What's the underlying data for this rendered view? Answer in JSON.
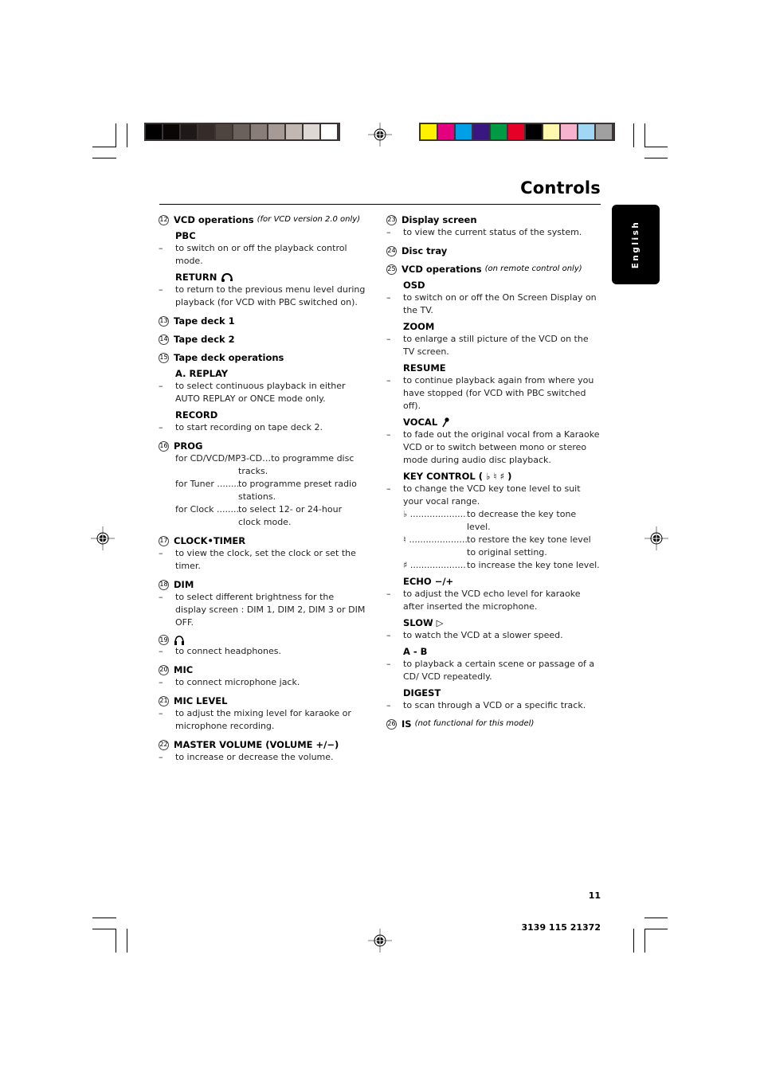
{
  "page": {
    "title": "Controls",
    "language_tab": "English",
    "page_number": "11",
    "doc_code": "3139 115 21372"
  },
  "print_marks": {
    "gray_bar_colors": [
      "#000000",
      "#0a0606",
      "#1e1917",
      "#352c2a",
      "#4e4541",
      "#6a605c",
      "#887d79",
      "#a69a96",
      "#c1b7b3",
      "#ded8d5",
      "#ffffff"
    ],
    "color_bar_colors": [
      "#fff100",
      "#e4007f",
      "#00a0e9",
      "#3a1780",
      "#009a44",
      "#e60027",
      "#000000",
      "#fff9b0",
      "#f6b3cb",
      "#a1d7f4",
      "#a0a0a0"
    ]
  },
  "left_column": [
    {
      "num": "12",
      "title": "VCD operations",
      "note": "(for VCD version 2.0 only)",
      "subs": [
        {
          "label": "PBC",
          "icon": "",
          "desc": "to switch on or off the playback control mode."
        },
        {
          "label": "RETURN",
          "icon": "return-icon",
          "desc": "to return to the previous menu level during playback (for VCD with PBC switched on)."
        }
      ]
    },
    {
      "num": "13",
      "title": "Tape deck 1"
    },
    {
      "num": "14",
      "title": "Tape deck 2"
    },
    {
      "num": "15",
      "title": "Tape deck operations",
      "subs": [
        {
          "label": "A. REPLAY",
          "desc": "to select continuous playback in either AUTO REPLAY or ONCE mode only."
        },
        {
          "label": "RECORD",
          "desc": "to start recording on tape deck 2."
        }
      ]
    },
    {
      "num": "16",
      "title": "PROG",
      "intro": "for CD/VCD/MP3-CD…to programme disc",
      "intro_cont": "tracks.",
      "rows": [
        {
          "k": "for Tuner .............",
          "v": "to programme preset radio stations."
        },
        {
          "k": "for Clock ............",
          "v": "to select 12- or 24-hour clock mode."
        }
      ]
    },
    {
      "num": "17",
      "title": "CLOCK•TIMER",
      "desc": "to view the clock, set the clock or set the timer."
    },
    {
      "num": "18",
      "title": "DIM",
      "desc": "to select different brightness for the display screen : DIM 1, DIM 2, DIM 3 or DIM OFF."
    },
    {
      "num": "19",
      "title": "",
      "icon": "headphones-icon",
      "desc": "to connect headphones."
    },
    {
      "num": "20",
      "title": "MIC",
      "desc": "to connect microphone jack."
    },
    {
      "num": "21",
      "title": "MIC LEVEL",
      "desc": "to adjust the mixing level for karaoke or microphone recording."
    },
    {
      "num": "22",
      "title": "MASTER VOLUME  (VOLUME +/−)",
      "desc": "to increase or decrease the volume."
    }
  ],
  "right_column": [
    {
      "num": "23",
      "title": "Display screen",
      "desc": "to view the current status of the system."
    },
    {
      "num": "24",
      "title": "Disc tray"
    },
    {
      "num": "25",
      "title": "VCD operations",
      "note": "(on remote control only)",
      "subs": [
        {
          "label": "OSD",
          "desc": "to switch on or off the On Screen Display on the TV."
        },
        {
          "label": "ZOOM",
          "desc": "to enlarge a still picture of the VCD on the TV screen."
        },
        {
          "label": "RESUME",
          "desc": "to continue playback again from where you have stopped (for VCD with PBC switched off)."
        },
        {
          "label": "VOCAL",
          "icon": "microphone-icon",
          "desc": "to fade out the original vocal from a Karaoke VCD or to switch between mono or stereo mode during audio disc playback."
        },
        {
          "label": "KEY CONTROL ( ♭ ♮ ♯  )",
          "desc": "to change the VCD key tone level to suit your vocal range.",
          "rows": [
            {
              "k": "♭  ..........................",
              "v": "to decrease the key tone level."
            },
            {
              "k": "♮ ..............................",
              "v": "to restore the key tone level to original setting."
            },
            {
              "k": "♯ ..............................",
              "v": "to increase the key tone level."
            }
          ]
        },
        {
          "label": "ECHO  −/+",
          "desc": "to adjust the VCD echo level for karaoke after inserted the microphone."
        },
        {
          "label": "SLOW ▷",
          "desc": "to watch the VCD at a slower speed."
        },
        {
          "label": "A - B",
          "desc": "to playback a certain scene or passage of a CD/ VCD repeatedly."
        },
        {
          "label": "DIGEST",
          "desc": "to scan through a VCD or a specific track."
        }
      ]
    },
    {
      "num": "26",
      "title": "IS",
      "note": "(not functional for this model)"
    }
  ]
}
